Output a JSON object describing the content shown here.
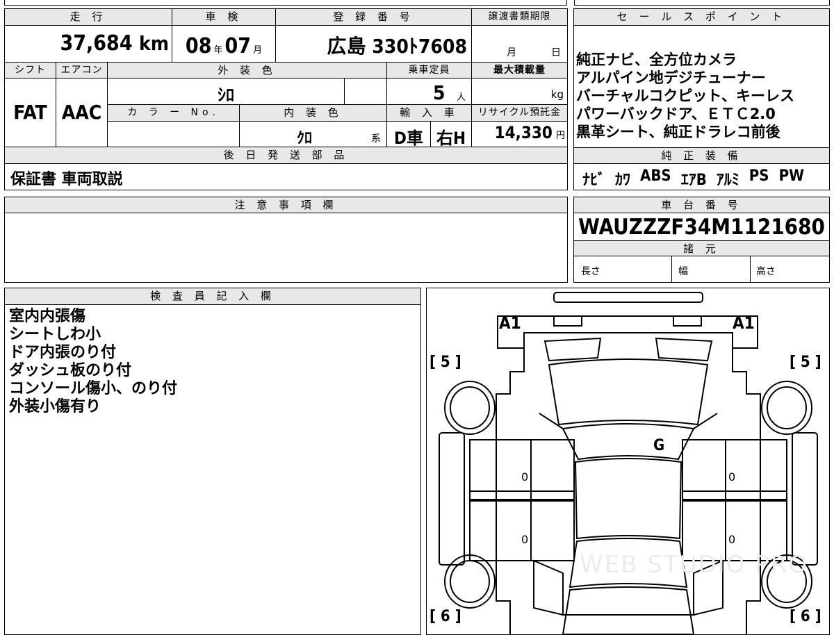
{
  "top_strip_fragment": "",
  "vehicle": {
    "mileage_label": "走 行",
    "mileage_value": "37,684",
    "mileage_unit": "km",
    "inspection_label": "車 検",
    "inspection_year": "08",
    "inspection_year_unit": "年",
    "inspection_month": "07",
    "inspection_month_unit": "月",
    "reg_label": "登 録 番 号",
    "reg_value": "広島 330ﾄ7608",
    "transfer_label": "譲渡書類期限",
    "transfer_month_unit": "月",
    "transfer_day_unit": "日",
    "shift_label": "シフト",
    "shift_value": "FAT",
    "ac_label": "エアコン",
    "ac_value": "AAC",
    "ext_color_label": "外 装 色",
    "ext_color_value": "ｼﾛ",
    "capacity_label": "乗車定員",
    "capacity_value": "5",
    "capacity_unit": "人",
    "max_load_label": "最大積載量",
    "max_load_unit": "kg",
    "color_no_label": "カ ラ ー No.",
    "int_color_label": "内 装 色",
    "int_color_value": "ｸﾛ",
    "int_color_suffix": "系",
    "import_label": "輸 入 車",
    "import_value": "D車",
    "steering_value": "右H",
    "recycle_label": "リサイクル預託金",
    "recycle_value": "14,330",
    "recycle_unit": "円",
    "later_parts_label": "後 日 発 送 部 品",
    "later_parts_value": "保証書 車両取説"
  },
  "sales_points": {
    "label": "セ ー ル ス ポ イ ン ト",
    "lines": [
      "純正ナビ、全方位カメラ",
      "アルパイン地デジチューナー",
      "バーチャルコクピット、キーレス",
      "パワーバックドア、ＥＴＣ2.0",
      "黒革シート、純正ドラレコ前後"
    ]
  },
  "equipment": {
    "label": "純 正 装 備",
    "items": [
      "ﾅﾋﾞ",
      "ｶﾜ",
      "ABS",
      "ｴｱB",
      "ｱﾙﾐ",
      "PS",
      "PW"
    ]
  },
  "notes": {
    "label": "注 意 事 項 欄",
    "text": ""
  },
  "chassis": {
    "label": "車 台 番 号",
    "value": "WAUZZZF34M1121680"
  },
  "specs": {
    "label": "諸 元",
    "length_label": "長さ",
    "width_label": "幅",
    "height_label": "高さ"
  },
  "inspector": {
    "label": "検 査 員 記 入 欄",
    "lines": [
      "室内内張傷",
      "シートしわ小",
      "ドア内張のり付",
      "ダッシュ板のり付",
      "コンソール傷小、のり付",
      "外装小傷有り"
    ]
  },
  "diagram": {
    "front_left_mark": "A1",
    "front_right_mark": "A1",
    "front_tyre_left": "[ 5 ]",
    "front_tyre_right": "[ 5 ]",
    "rear_tyre_left": "[ 6 ]",
    "rear_tyre_right": "[ 6 ]",
    "windshield_mark": "G",
    "door_marks": [
      "0",
      "0",
      "0",
      "0"
    ],
    "watermark": "WEB STUDIO PRO"
  }
}
